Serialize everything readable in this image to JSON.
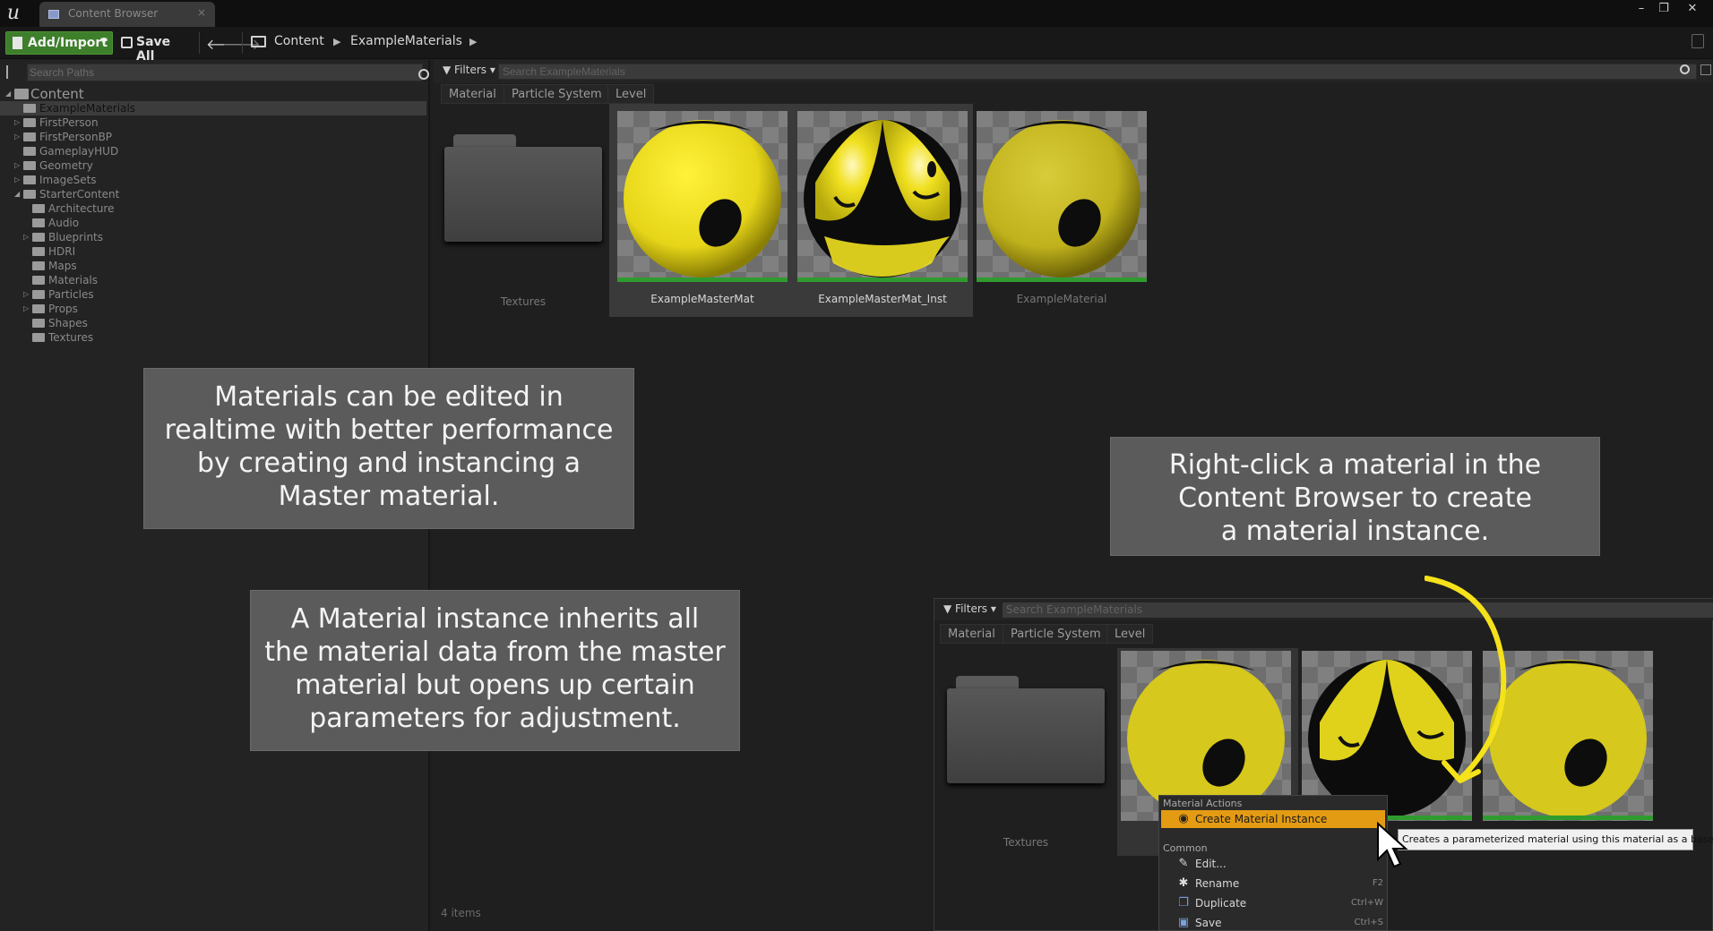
{
  "window": {
    "tab_title": "Content Browser",
    "controls": [
      "minimize-icon",
      "maximize-icon",
      "close-icon"
    ]
  },
  "toolbar": {
    "add_import": "Add/Import",
    "save_all": "Save All",
    "breadcrumb": [
      "Content",
      "ExampleMaterials"
    ]
  },
  "paths": {
    "search_placeholder": "Search Paths",
    "tree": [
      {
        "label": "Content",
        "level": 0,
        "expanded": true
      },
      {
        "label": "ExampleMaterials",
        "level": 1,
        "selected": true
      },
      {
        "label": "FirstPerson",
        "level": 1
      },
      {
        "label": "FirstPersonBP",
        "level": 1
      },
      {
        "label": "GameplayHUD",
        "level": 1
      },
      {
        "label": "Geometry",
        "level": 1
      },
      {
        "label": "ImageSets",
        "level": 1
      },
      {
        "label": "StarterContent",
        "level": 1,
        "expanded": true
      },
      {
        "label": "Architecture",
        "level": 2
      },
      {
        "label": "Audio",
        "level": 2
      },
      {
        "label": "Blueprints",
        "level": 2
      },
      {
        "label": "HDRI",
        "level": 2
      },
      {
        "label": "Maps",
        "level": 2
      },
      {
        "label": "Materials",
        "level": 2
      },
      {
        "label": "Particles",
        "level": 2
      },
      {
        "label": "Props",
        "level": 2
      },
      {
        "label": "Shapes",
        "level": 2
      },
      {
        "label": "Textures",
        "level": 2
      }
    ]
  },
  "assets": {
    "filters_label": "Filters",
    "search_placeholder": "Search ExampleMaterials",
    "filter_chips": [
      "Material",
      "Particle System",
      "Level"
    ],
    "items": [
      {
        "label": "Textures",
        "type": "folder"
      },
      {
        "label": "ExampleMasterMat",
        "type": "material"
      },
      {
        "label": "ExampleMasterMat_Inst",
        "type": "material_instance"
      },
      {
        "label": "ExampleMaterial",
        "type": "material"
      }
    ],
    "item_count": "4 items"
  },
  "callouts": {
    "master": [
      "Materials can be edited in",
      "realtime with better performance",
      "by creating and instancing a",
      "Master material."
    ],
    "instance": [
      "A Material instance inherits all",
      "the material data from the master",
      "material but opens up certain",
      "parameters for adjustment."
    ],
    "rightclick": [
      "Right-click a material in the",
      "Content Browser to create",
      "a material instance."
    ]
  },
  "inset": {
    "filters_label": "Filters",
    "search_placeholder": "Search ExampleMaterials",
    "filter_chips": [
      "Material",
      "Particle System",
      "Level"
    ],
    "folder_label": "Textures",
    "menu": {
      "section_material": "Material Actions",
      "create_instance": "Create Material Instance",
      "section_common": "Common",
      "edit": "Edit...",
      "rename": "Rename",
      "rename_shortcut": "F2",
      "duplicate": "Duplicate",
      "duplicate_shortcut": "Ctrl+W",
      "save": "Save",
      "save_shortcut": "Ctrl+S"
    },
    "tooltip": "Creates a parameterized material using this material as a base."
  },
  "colors": {
    "add_button": "#3d7f2a",
    "highlight": "#e39b13",
    "annotation_arrow": "#f5e21a",
    "sphere_yellow": "#e8d820"
  }
}
